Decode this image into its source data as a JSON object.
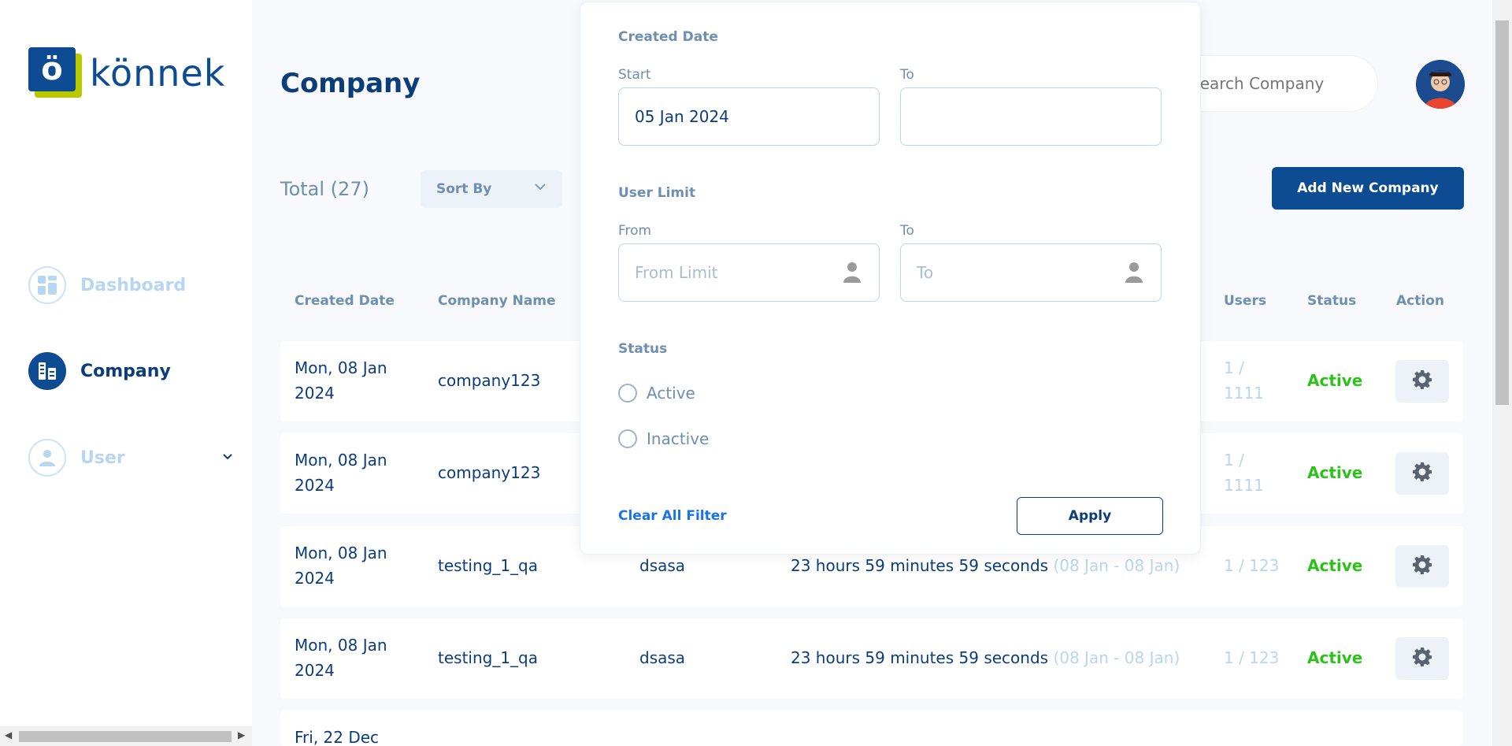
{
  "brand": {
    "name": "könnek",
    "mark": "ö"
  },
  "sidebar": {
    "items": [
      {
        "label": "Dashboard",
        "icon": "dashboard-grid-icon",
        "active": false
      },
      {
        "label": "Company",
        "icon": "company-buildings-icon",
        "active": true
      },
      {
        "label": "User",
        "icon": "user-icon",
        "active": false,
        "has_submenu": true
      }
    ]
  },
  "header": {
    "title": "Company",
    "search_placeholder": "Search Company"
  },
  "toolbar": {
    "total": "Total (27)",
    "sort_label": "Sort By",
    "add_button": "Add New Company"
  },
  "table": {
    "columns": [
      "Created Date",
      "Company Name",
      "Users",
      "Status",
      "Action"
    ],
    "rows": [
      {
        "date_line1": "Mon, 08 Jan",
        "date_line2": "2024",
        "company": "company123",
        "users_line1": "1 /",
        "users_line2": "1111",
        "status": "Active"
      },
      {
        "date_line1": "Mon, 08 Jan",
        "date_line2": "2024",
        "company": "company123",
        "users_line1": "1 /",
        "users_line2": "1111",
        "status": "Active"
      },
      {
        "date_line1": "Mon, 08 Jan",
        "date_line2": "2024",
        "company": "testing_1_qa",
        "col3": "dsasa",
        "duration": "23 hours 59 minutes 59 seconds",
        "range": "(08 Jan - 08 Jan)",
        "users": "1 / 123",
        "status": "Active"
      },
      {
        "date_line1": "Mon, 08 Jan",
        "date_line2": "2024",
        "company": "testing_1_qa",
        "col3": "dsasa",
        "duration": "23 hours 59 minutes 59 seconds",
        "range": "(08 Jan - 08 Jan)",
        "users": "1 / 123",
        "status": "Active"
      },
      {
        "date_line1": "Fri, 22 Dec"
      }
    ]
  },
  "filter": {
    "created_date": {
      "title": "Created Date",
      "start_label": "Start",
      "start_value": "05 Jan 2024",
      "to_label": "To",
      "to_value": ""
    },
    "user_limit": {
      "title": "User Limit",
      "from_label": "From",
      "from_placeholder": "From Limit",
      "to_label": "To",
      "to_placeholder": "To"
    },
    "status": {
      "title": "Status",
      "options": [
        "Active",
        "Inactive"
      ]
    },
    "clear_label": "Clear All Filter",
    "apply_label": "Apply"
  },
  "colors": {
    "primary": "#0d4c92",
    "accent_green": "#b8c900",
    "status_active": "#2cc21a",
    "muted": "#6d8fb0"
  }
}
